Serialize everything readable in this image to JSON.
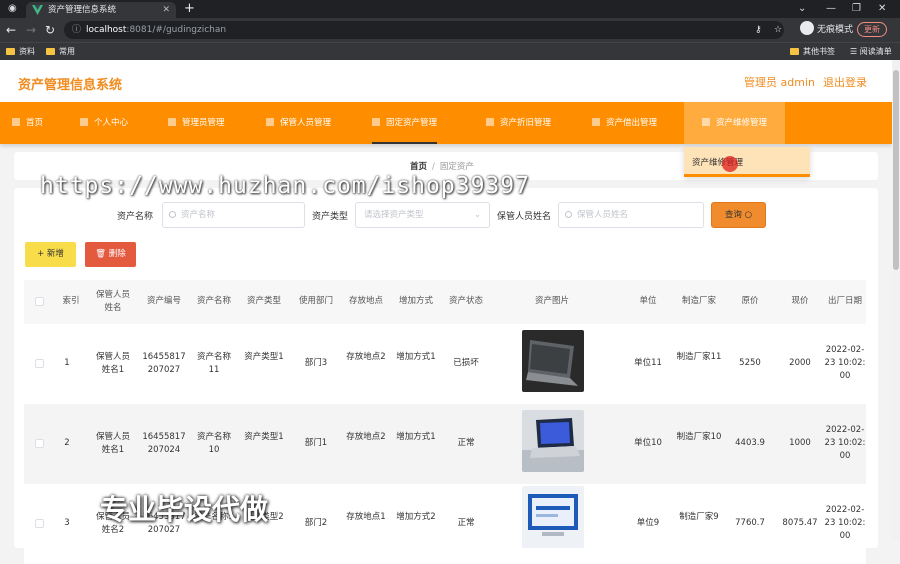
{
  "browser": {
    "tab_title": "资产管理信息系统",
    "url_host": "localhost",
    "url_path": ":8081/#/gudingzichan",
    "incognito_label": "无痕模式",
    "update_label": "更新",
    "bookmarks": [
      "资料",
      "常用"
    ],
    "other_bookmarks": "其他书签",
    "reading_list": "阅读清单"
  },
  "header": {
    "brand": "资产管理信息系统",
    "admin": "管理员 admin",
    "logout": "退出登录"
  },
  "menu": {
    "items": [
      "首页",
      "个人中心",
      "管理员管理",
      "保管人员管理",
      "固定资产管理",
      "资产折旧管理",
      "资产借出管理",
      "资产维修管理"
    ],
    "dropdown_item": "资产维修管理"
  },
  "breadcrumb": {
    "home": "首页",
    "sep": "/",
    "current": "固定资产"
  },
  "search": {
    "name_label": "资产名称",
    "name_placeholder": "资产名称",
    "type_label": "资产类型",
    "type_placeholder": "请选择资产类型",
    "keeper_label": "保管人员姓名",
    "keeper_placeholder": "保管人员姓名",
    "search_button": "查询"
  },
  "actions": {
    "add": "+ 新增",
    "delete": "删除"
  },
  "table": {
    "headers": [
      "索引",
      "保管人员姓名",
      "资产编号",
      "资产名称",
      "资产类型",
      "使用部门",
      "存放地点",
      "增加方式",
      "资产状态",
      "资产图片",
      "单位",
      "制造厂家",
      "原价",
      "现价",
      "出厂日期"
    ],
    "rows": [
      {
        "index": "1",
        "keeper": "保管人员姓名1",
        "code": "16455817207027",
        "name": "资产名称11",
        "type": "资产类型1",
        "dept": "部门3",
        "location": "存放地点2",
        "method": "增加方式1",
        "status": "已损坏",
        "unit": "单位11",
        "maker": "制造厂家11",
        "orig": "5250",
        "now": "2000",
        "date": "2022-02-23 10:02:00"
      },
      {
        "index": "2",
        "keeper": "保管人员姓名1",
        "code": "16455817207024",
        "name": "资产名称10",
        "type": "资产类型1",
        "dept": "部门1",
        "location": "存放地点2",
        "method": "增加方式1",
        "status": "正常",
        "unit": "单位10",
        "maker": "制造厂家10",
        "orig": "4403.9",
        "now": "1000",
        "date": "2022-02-23 10:02:00"
      },
      {
        "index": "3",
        "keeper": "保管人员姓名2",
        "code": "16455817207027",
        "name": "资产名称9",
        "type": "资产类型2",
        "dept": "部门2",
        "location": "存放地点1",
        "method": "增加方式2",
        "status": "正常",
        "unit": "单位9",
        "maker": "制造厂家9",
        "orig": "7760.7",
        "now": "8075.47",
        "date": "2022-02-23 10:02:00"
      }
    ]
  },
  "watermarks": {
    "url": "https://www.huzhan.com/ishop39397",
    "promo": "专业毕设代做"
  }
}
